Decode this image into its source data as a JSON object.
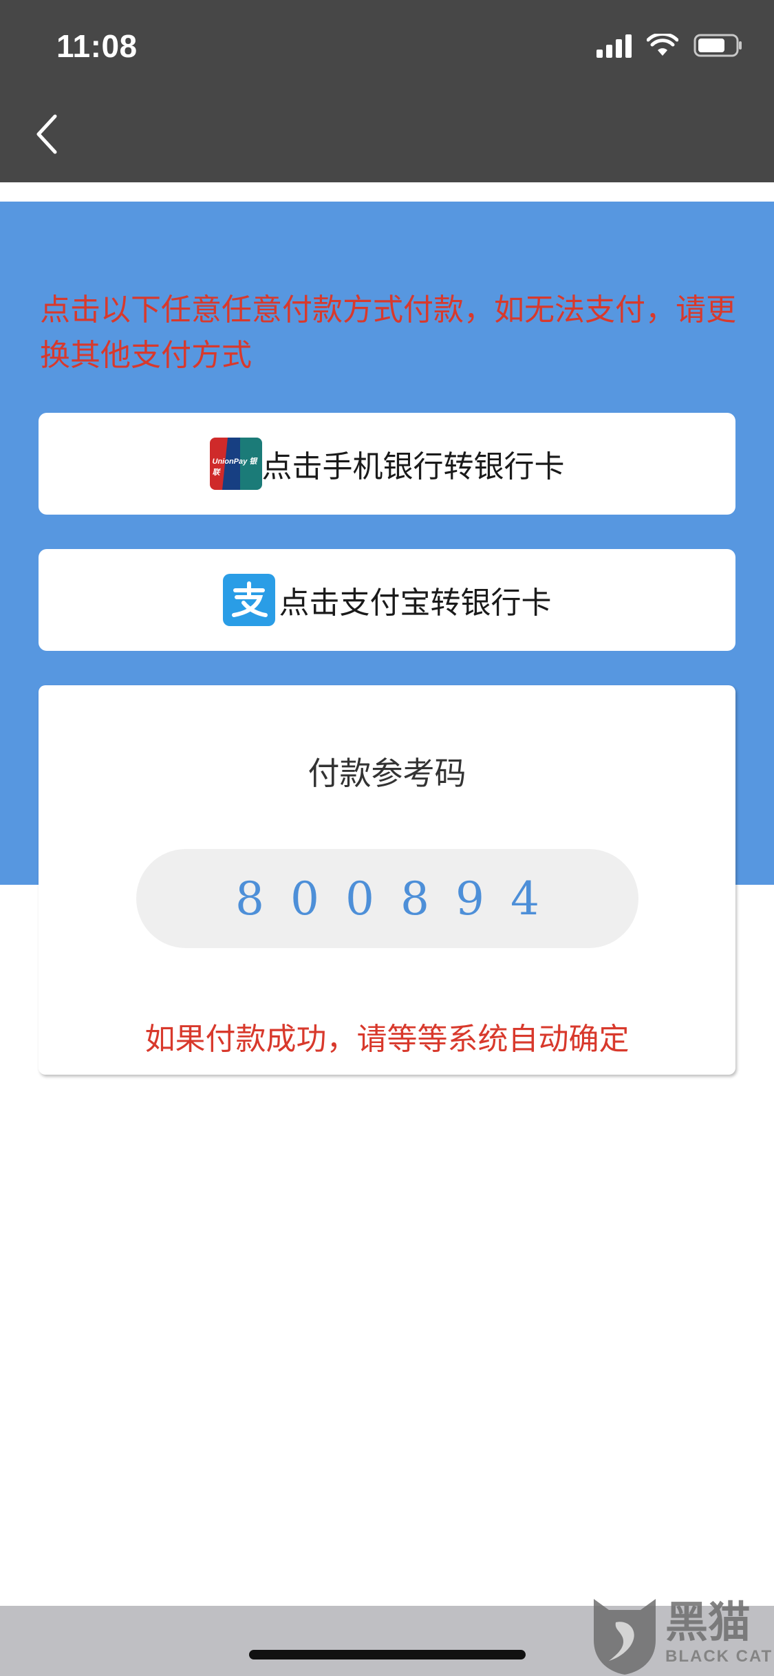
{
  "status_bar": {
    "time": "11:08"
  },
  "header": {
    "back_icon": "chevron-left-icon"
  },
  "instruction": "点击以下任意任意付款方式付款，如无法支付，请更换其他支付方式",
  "payment_options": [
    {
      "label": "点击手机银行转银行卡",
      "icon": "unionpay-icon",
      "icon_text": "UnionPay 银联"
    },
    {
      "label": "点击支付宝转银行卡",
      "icon": "alipay-icon"
    }
  ],
  "reference_card": {
    "title": "付款参考码",
    "code": "800894",
    "note": "如果付款成功，请等等系统自动确定"
  },
  "watermark": {
    "cn": "黑猫",
    "en": "BLACK CAT"
  },
  "colors": {
    "header_bg": "#474747",
    "panel_blue": "#5797e0",
    "warning_red": "#d8392c",
    "code_blue": "#4d8fd8"
  }
}
